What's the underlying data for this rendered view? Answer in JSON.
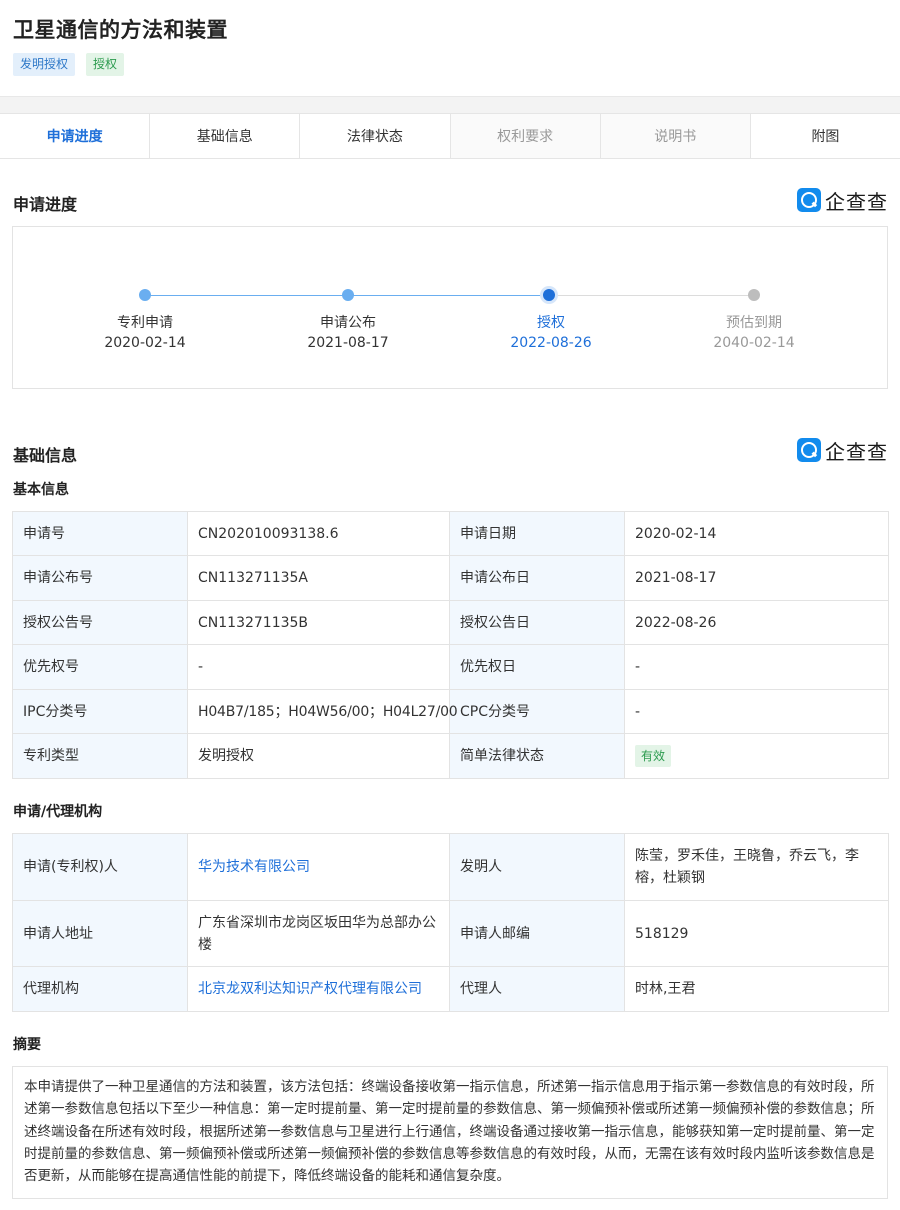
{
  "header": {
    "title": "卫星通信的方法和装置",
    "tags": [
      "发明授权",
      "授权"
    ]
  },
  "tabs": [
    {
      "label": "申请进度"
    },
    {
      "label": "基础信息"
    },
    {
      "label": "法律状态"
    },
    {
      "label": "权利要求"
    },
    {
      "label": "说明书"
    },
    {
      "label": "附图"
    }
  ],
  "brand": {
    "name": "企查查"
  },
  "progress": {
    "title": "申请进度",
    "steps": [
      {
        "label": "专利申请",
        "date": "2020-02-14",
        "state": "done"
      },
      {
        "label": "申请公布",
        "date": "2021-08-17",
        "state": "done"
      },
      {
        "label": "授权",
        "date": "2022-08-26",
        "state": "current"
      },
      {
        "label": "预估到期",
        "date": "2040-02-14",
        "state": "future"
      }
    ]
  },
  "basic": {
    "title": "基础信息",
    "subtitle": "基本信息",
    "rows": [
      {
        "k1": "申请号",
        "v1": "CN202010093138.6",
        "k2": "申请日期",
        "v2": "2020-02-14"
      },
      {
        "k1": "申请公布号",
        "v1": "CN113271135A",
        "k2": "申请公布日",
        "v2": "2021-08-17"
      },
      {
        "k1": "授权公告号",
        "v1": "CN113271135B",
        "k2": "授权公告日",
        "v2": "2022-08-26"
      },
      {
        "k1": "优先权号",
        "v1": "-",
        "k2": "优先权日",
        "v2": "-"
      },
      {
        "k1": "IPC分类号",
        "v1": "H04B7/185；H04W56/00；H04L27/00",
        "k2": "CPC分类号",
        "v2": "-"
      },
      {
        "k1": "专利类型",
        "v1": "发明授权",
        "k2": "简单法律状态",
        "v2": "有效"
      }
    ]
  },
  "agency": {
    "subtitle": "申请/代理机构",
    "rows": [
      {
        "k1": "申请(专利权)人",
        "v1": "华为技术有限公司",
        "k2": "发明人",
        "v2": "陈莹，罗禾佳，王晓鲁，乔云飞，李榕，杜颖钢"
      },
      {
        "k1": "申请人地址",
        "v1": "广东省深圳市龙岗区坂田华为总部办公楼",
        "k2": "申请人邮编",
        "v2": "518129"
      },
      {
        "k1": "代理机构",
        "v1": "北京龙双利达知识产权代理有限公司",
        "k2": "代理人",
        "v2": "时林,王君"
      }
    ]
  },
  "abstract": {
    "subtitle": "摘要",
    "text": "本申请提供了一种卫星通信的方法和装置，该方法包括：终端设备接收第一指示信息，所述第一指示信息用于指示第一参数信息的有效时段，所述第一参数信息包括以下至少一种信息：第一定时提前量、第一定时提前量的参数信息、第一频偏预补偿或所述第一频偏预补偿的参数信息；所述终端设备在所述有效时段，根据所述第一参数信息与卫星进行上行通信，终端设备通过接收第一指示信息，能够获知第一定时提前量、第一定时提前量的参数信息、第一频偏预补偿或所述第一频偏预补偿的参数信息等参数信息的有效时段，从而，无需在该有效时段内监听该参数信息是否更新，从而能够在提高通信性能的前提下，降低终端设备的能耗和通信复杂度。"
  },
  "colors": {
    "accent": "#1e6fd9",
    "label_bg": "#f2f8fe",
    "valid": "#2c9b4f"
  }
}
